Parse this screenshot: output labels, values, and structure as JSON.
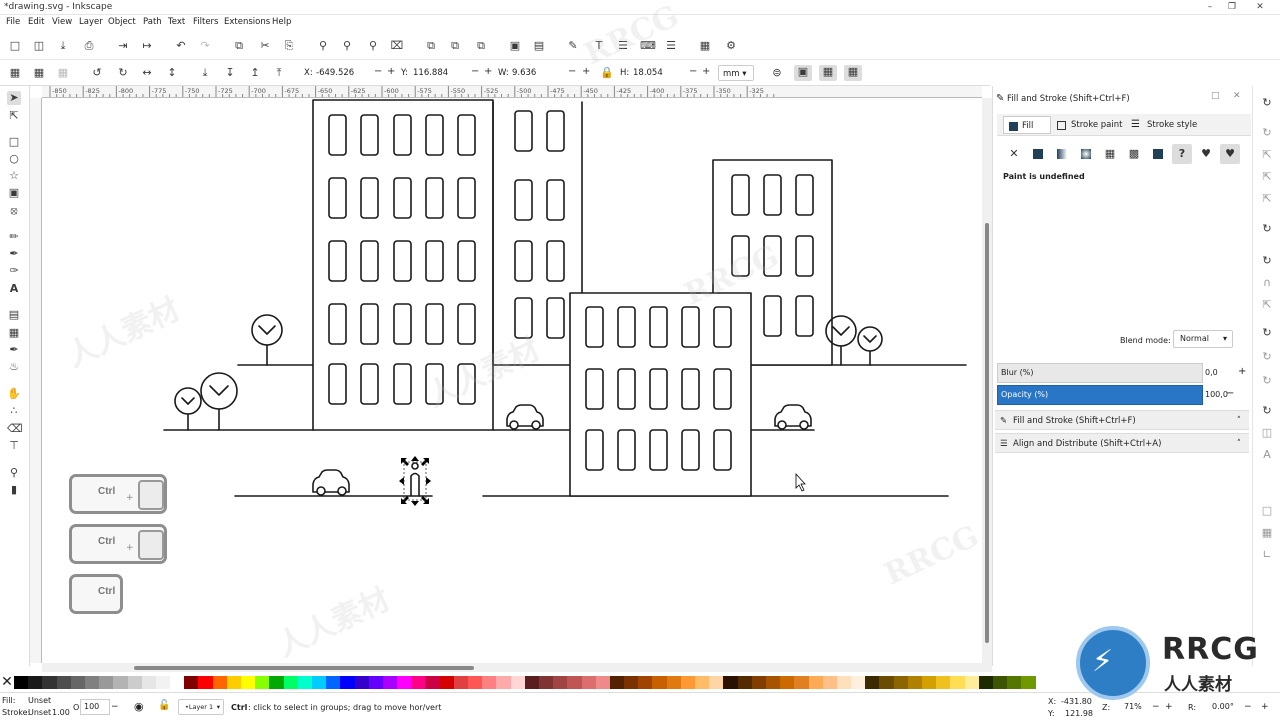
{
  "window": {
    "title": "*drawing.svg - Inkscape"
  },
  "menu": [
    "File",
    "Edit",
    "View",
    "Layer",
    "Object",
    "Path",
    "Text",
    "Filters",
    "Extensions",
    "Help"
  ],
  "controls": {
    "x_label": "X:",
    "x_value": "-649.526",
    "y_label": "Y:",
    "y_value": "116.884",
    "w_label": "W:",
    "w_value": "9.636",
    "h_label": "H:",
    "h_value": "18.054",
    "unit": "mm"
  },
  "ruler_ticks": [
    "-850",
    "-825",
    "-800",
    "-775",
    "-750",
    "-725",
    "-700",
    "-675",
    "-650",
    "-625",
    "-600",
    "-575",
    "-550",
    "-525",
    "-500",
    "-475",
    "-450",
    "-425",
    "-400",
    "-375",
    "-350",
    "-325"
  ],
  "overlay": {
    "key_label": "Ctrl",
    "plus": "+"
  },
  "dock": {
    "title": "Fill and Stroke (Shift+Ctrl+F)",
    "tabs": [
      "Fill",
      "Stroke paint",
      "Stroke style"
    ],
    "paint_status": "Paint is undefined",
    "blend_label": "Blend mode:",
    "blend_value": "Normal",
    "blur_label": "Blur (%)",
    "blur_value": "0,0",
    "opacity_label": "Opacity (%)",
    "opacity_value": "100,0",
    "panels": [
      "Fill and Stroke (Shift+Ctrl+F)",
      "Align and Distribute (Shift+Ctrl+A)"
    ]
  },
  "status": {
    "fill_label": "Fill:",
    "fill_value": "Unset",
    "stroke_label": "Stroke:",
    "stroke_value": "Unset",
    "stroke_width": "1.00",
    "opacity_label": "O:",
    "opacity_value": "100",
    "layer": "•Layer 1",
    "message_key": "Ctrl",
    "message": ": click to select in groups; drag to move hor/vert",
    "coord_x": "-431.80",
    "coord_y": "121.98",
    "zoom_label": "Z:",
    "zoom_value": "71%",
    "rotate_label": "R:",
    "rotate_value": "0.00°"
  },
  "watermark": {
    "brand": "RRCG",
    "subtitle": "人人素材"
  },
  "palette_colors": [
    "#000000",
    "#1a1a1a",
    "#333333",
    "#4d4d4d",
    "#666666",
    "#808080",
    "#999999",
    "#b3b3b3",
    "#cccccc",
    "#e6e6e6",
    "#f2f2f2",
    "#ffffff",
    "#800000",
    "#ff0000",
    "#ff6600",
    "#ffcc00",
    "#ffff00",
    "#88ff00",
    "#00aa00",
    "#00ff66",
    "#00ffcc",
    "#00ccff",
    "#0066ff",
    "#0000ff",
    "#3300cc",
    "#6600ff",
    "#aa00ff",
    "#ff00ff",
    "#ff0088",
    "#cc0044",
    "#d40000",
    "#e04040",
    "#ff5555",
    "#ff8080",
    "#ffaaaa",
    "#ffd5d5",
    "#5a1e1e",
    "#803333",
    "#a04444",
    "#c05555",
    "#dd6e6e",
    "#f08a8a",
    "#552200",
    "#7a3300",
    "#a04400",
    "#c86000",
    "#e07a10",
    "#ff9933",
    "#ffbb66",
    "#ffd5a5",
    "#2b1100",
    "#552b00",
    "#803f00",
    "#a65400",
    "#cc6a00",
    "#e08020",
    "#ffaa55",
    "#ffc088",
    "#ffe0bb",
    "#fff0dd",
    "#3d2b00",
    "#6b4c00",
    "#8c6400",
    "#b08000",
    "#d4a000",
    "#f0c020",
    "#ffdd55",
    "#ffee99",
    "#1e2b00",
    "#3d5500",
    "#557700",
    "#6e9a00"
  ]
}
